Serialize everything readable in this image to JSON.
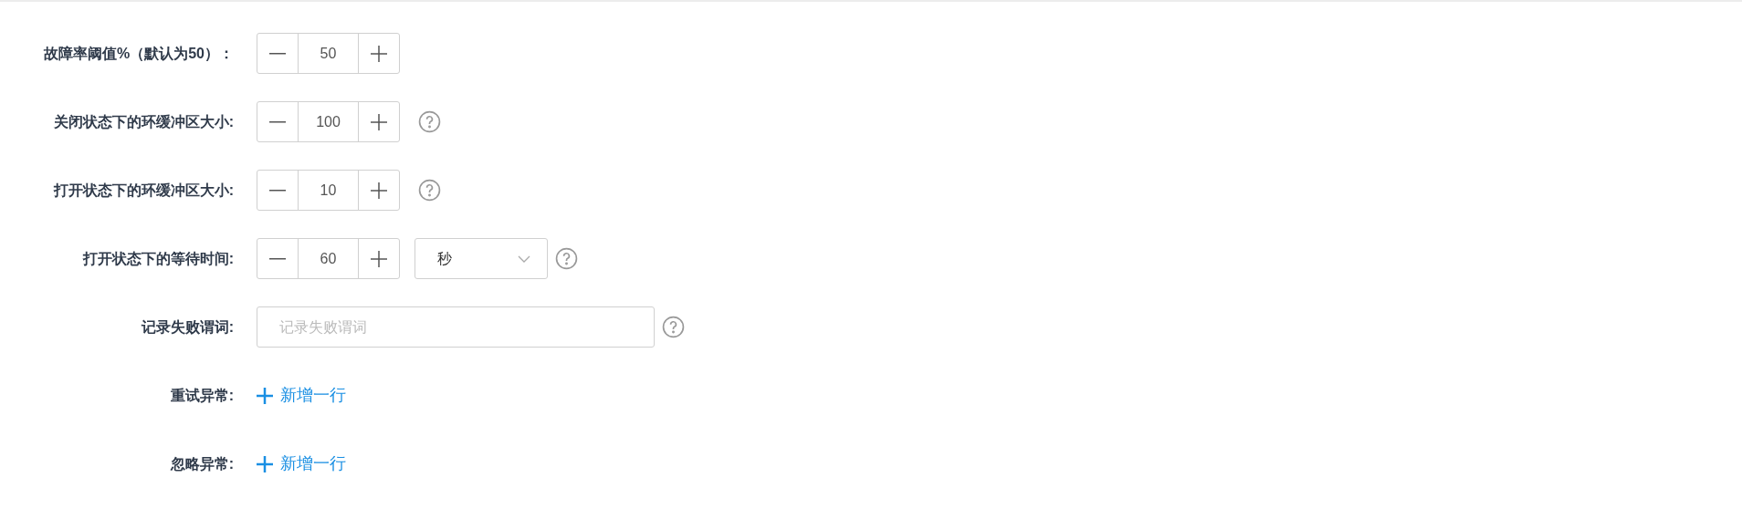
{
  "fields": [
    {
      "kind": "stepper",
      "label": "故障率阈值%（默认为50）：",
      "value": "50",
      "help": false
    },
    {
      "kind": "stepper",
      "label": "关闭状态下的环缓冲区大小:",
      "value": "100",
      "help": true
    },
    {
      "kind": "stepper",
      "label": "打开状态下的环缓冲区大小:",
      "value": "10",
      "help": true
    },
    {
      "kind": "stepper",
      "label": "打开状态下的等待时间:",
      "value": "60",
      "unit": "秒",
      "help": true
    },
    {
      "kind": "text",
      "label": "记录失败谓词:",
      "placeholder": "记录失败谓词",
      "help": true
    },
    {
      "kind": "add",
      "label": "重试异常:",
      "link": "新增一行",
      "help": false
    },
    {
      "kind": "add",
      "label": "忽略异常:",
      "link": "新增一行",
      "help": false
    }
  ]
}
